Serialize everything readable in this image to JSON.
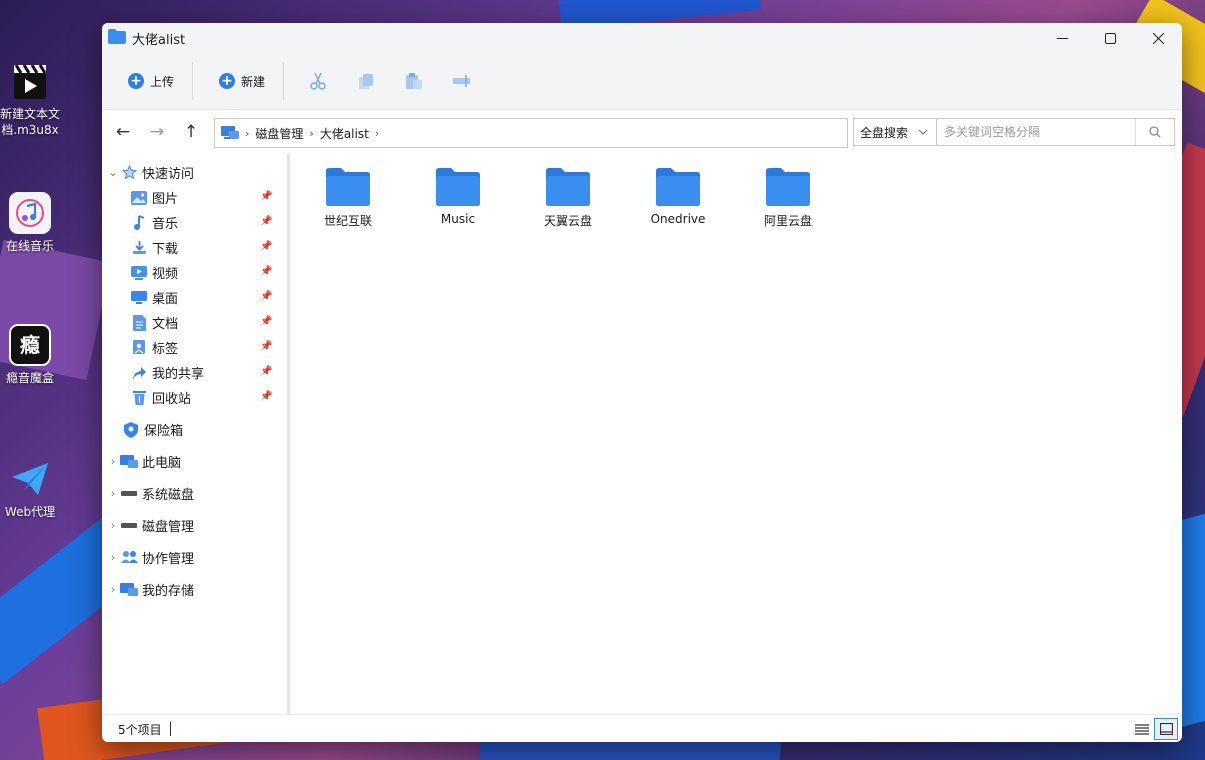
{
  "desktop": {
    "icons": [
      {
        "label": "新建文本文\n档.m3u8x",
        "icon": "clapperboard-icon"
      },
      {
        "label": "在线音乐",
        "icon": "music-app-icon"
      },
      {
        "label": "瘾音魔盒",
        "icon": "yinyin-app-icon",
        "glyph": "瘾"
      },
      {
        "label": "Web代理",
        "icon": "paper-plane-icon"
      }
    ]
  },
  "window": {
    "title": "大佬alist",
    "controls": {
      "minimize": "—",
      "maximize": "☐",
      "close": "✕"
    }
  },
  "toolbar": {
    "upload_label": "上传",
    "new_label": "新建",
    "icons": [
      "cut-icon",
      "copy-icon",
      "paste-icon",
      "rename-icon"
    ]
  },
  "nav": {
    "back": "←",
    "forward": "→",
    "up": "↑",
    "breadcrumb": [
      "磁盘管理",
      "大佬alist"
    ],
    "search_scope": "全盘搜索",
    "search_placeholder": "多关键词空格分隔"
  },
  "sidebar": {
    "quick_access": "快速访问",
    "quick_items": [
      {
        "label": "图片",
        "icon": "picture-icon"
      },
      {
        "label": "音乐",
        "icon": "music-note-icon"
      },
      {
        "label": "下载",
        "icon": "download-icon"
      },
      {
        "label": "视频",
        "icon": "video-icon"
      },
      {
        "label": "桌面",
        "icon": "desktop-icon"
      },
      {
        "label": "文档",
        "icon": "document-icon"
      },
      {
        "label": "标签",
        "icon": "tag-icon"
      },
      {
        "label": "我的共享",
        "icon": "share-icon"
      },
      {
        "label": "回收站",
        "icon": "recycle-bin-icon"
      }
    ],
    "vault": "保险箱",
    "sections": [
      {
        "label": "此电脑",
        "icon": "computer-icon"
      },
      {
        "label": "系统磁盘",
        "icon": "drive-icon"
      },
      {
        "label": "磁盘管理",
        "icon": "drive-icon"
      },
      {
        "label": "协作管理",
        "icon": "collaboration-icon"
      },
      {
        "label": "我的存储",
        "icon": "storage-icon"
      }
    ]
  },
  "content": {
    "folders": [
      "世纪互联",
      "Music",
      "天翼云盘",
      "Onedrive",
      "阿里云盘"
    ]
  },
  "status": {
    "count_text": "5个项目"
  },
  "colors": {
    "accent": "#2f7de9",
    "folder": "#3a8ef0",
    "folder_dark": "#2f79da"
  }
}
